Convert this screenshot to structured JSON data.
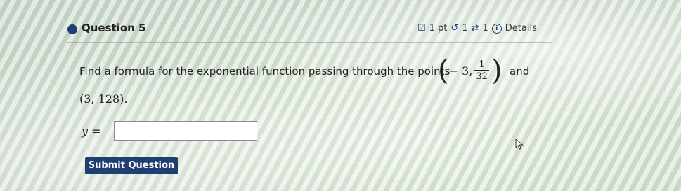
{
  "question": {
    "title": "Question 5",
    "points": "1 pt",
    "retries": "1",
    "attempts": "1",
    "details_label": "Details"
  },
  "prompt": {
    "text": "Find a formula for the exponential function passing through the points",
    "point1": {
      "x": "− 3,",
      "numerator": "1",
      "denominator": "32"
    },
    "and": "and",
    "point2": "(3, 128)."
  },
  "answer": {
    "label": "y =",
    "value": ""
  },
  "submit_label": "Submit Question",
  "icons": {
    "points": "checkbox-icon",
    "retries": "retry-icon",
    "attempts": "sync-icon",
    "details": "info-icon",
    "bullet": "question-bullet-icon",
    "cursor": "mouse-cursor-icon"
  },
  "colors": {
    "accent": "#1f3f73"
  }
}
